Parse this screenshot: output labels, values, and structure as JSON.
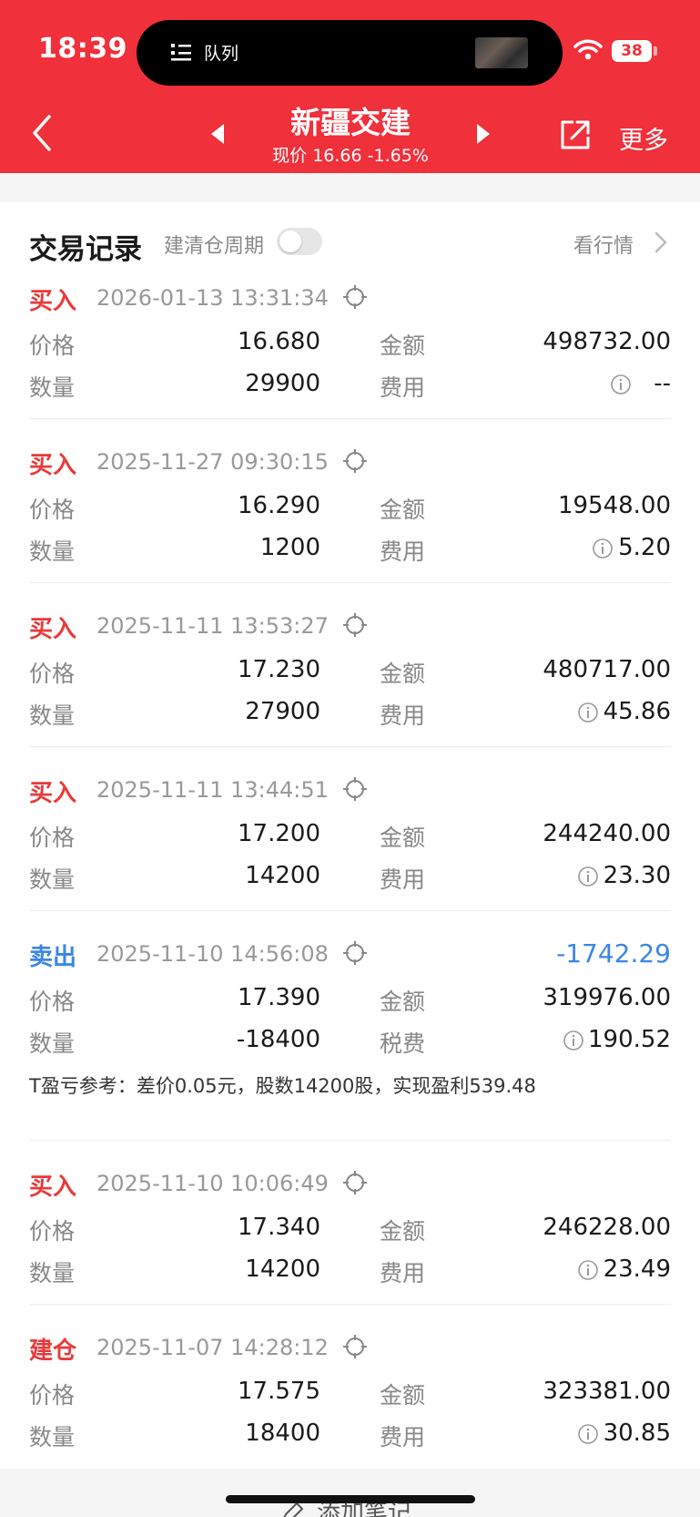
{
  "status_bar": {
    "time": "18:39",
    "island_label": "队列",
    "battery": "38"
  },
  "nav": {
    "title": "新疆交建",
    "price_line": "现价 16.66 -1.65%",
    "more": "更多"
  },
  "section": {
    "title": "交易记录",
    "cycle_label": "建清仓周期",
    "market_link": "看行情"
  },
  "labels": {
    "price": "价格",
    "qty": "数量",
    "amount": "金额",
    "fee": "费用",
    "tax_fee": "税费"
  },
  "records": [
    {
      "type": "买入",
      "kind": "buy",
      "date": "2026-01-13 13:31:34",
      "price": "16.680",
      "qty": "29900",
      "amount": "498732.00",
      "fee_label": "费用",
      "fee": "--"
    },
    {
      "type": "买入",
      "kind": "buy",
      "date": "2025-11-27 09:30:15",
      "price": "16.290",
      "qty": "1200",
      "amount": "19548.00",
      "fee_label": "费用",
      "fee": "5.20"
    },
    {
      "type": "买入",
      "kind": "buy",
      "date": "2025-11-11 13:53:27",
      "price": "17.230",
      "qty": "27900",
      "amount": "480717.00",
      "fee_label": "费用",
      "fee": "45.86"
    },
    {
      "type": "买入",
      "kind": "buy",
      "date": "2025-11-11 13:44:51",
      "price": "17.200",
      "qty": "14200",
      "amount": "244240.00",
      "fee_label": "费用",
      "fee": "23.30"
    },
    {
      "type": "卖出",
      "kind": "sell",
      "date": "2025-11-10 14:56:08",
      "profit": "-1742.29",
      "price": "17.390",
      "qty": "-18400",
      "amount": "319976.00",
      "fee_label": "税费",
      "fee": "190.52",
      "note": "T盈亏参考：差价0.05元，股数14200股，实现盈利539.48"
    },
    {
      "type": "买入",
      "kind": "buy",
      "date": "2025-11-10 10:06:49",
      "price": "17.340",
      "qty": "14200",
      "amount": "246228.00",
      "fee_label": "费用",
      "fee": "23.49"
    },
    {
      "type": "建仓",
      "kind": "open",
      "date": "2025-11-07 14:28:12",
      "price": "17.575",
      "qty": "18400",
      "amount": "323381.00",
      "fee_label": "费用",
      "fee": "30.85"
    }
  ],
  "footer": {
    "add_note": "添加笔记"
  },
  "colors": {
    "brand_red": "#f0303a",
    "buy_red": "#e83a3a",
    "sell_blue": "#3b86e6"
  }
}
